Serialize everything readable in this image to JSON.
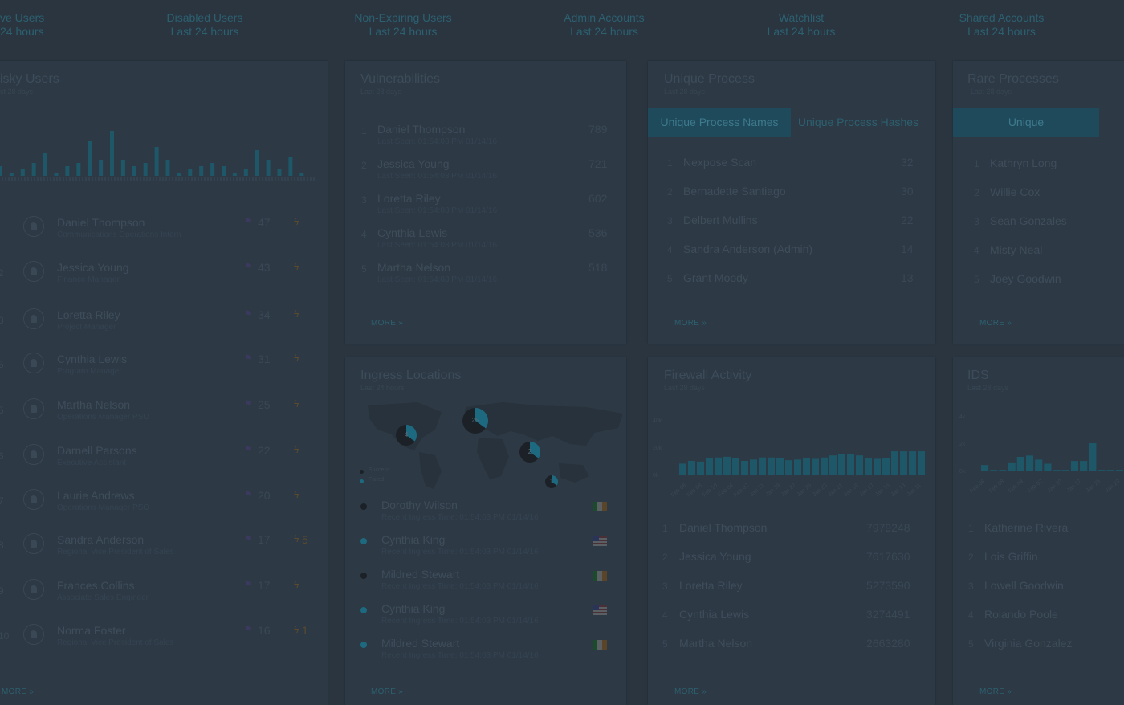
{
  "top_stats": [
    {
      "label": "ve Users",
      "sub": "24 hours"
    },
    {
      "label": "Disabled Users",
      "sub": "Last 24 hours"
    },
    {
      "label": "Non-Expiring Users",
      "sub": "Last 24 hours"
    },
    {
      "label": "Admin Accounts",
      "sub": "Last 24 hours"
    },
    {
      "label": "Watchlist",
      "sub": "Last 24 hours"
    },
    {
      "label": "Shared Accounts",
      "sub": "Last 24 hours"
    }
  ],
  "risky_users": {
    "title": "isky Users",
    "sub": "st 28 days",
    "more": "MORE »",
    "bars": [
      3,
      1,
      2,
      4,
      7,
      1,
      3,
      4,
      11,
      5,
      14,
      5,
      3,
      4,
      9,
      5,
      1,
      2,
      3,
      4,
      3,
      1,
      2,
      8,
      5,
      2,
      6,
      1
    ],
    "rows": [
      {
        "rank": "",
        "name": "Daniel Thompson",
        "role": "Communications Operations Intern",
        "flags": "47",
        "bolts": ""
      },
      {
        "rank": "2",
        "name": "Jessica Young",
        "role": "Finance Manager",
        "flags": "43",
        "bolts": ""
      },
      {
        "rank": "3",
        "name": "Loretta Riley",
        "role": "Project Manager",
        "flags": "34",
        "bolts": ""
      },
      {
        "rank": "5",
        "name": "Cynthia Lewis",
        "role": "Program Manager",
        "flags": "31",
        "bolts": ""
      },
      {
        "rank": "5",
        "name": "Martha Nelson",
        "role": "Operations Manager PSO",
        "flags": "25",
        "bolts": ""
      },
      {
        "rank": "6",
        "name": "Darnell Parsons",
        "role": "Executive Assistant",
        "flags": "22",
        "bolts": ""
      },
      {
        "rank": "7",
        "name": "Laurie Andrews",
        "role": "Operations Manager PSO",
        "flags": "20",
        "bolts": ""
      },
      {
        "rank": "8",
        "name": "Sandra Anderson",
        "role": "Regional Vice President of Sales",
        "flags": "17",
        "bolts": "5"
      },
      {
        "rank": "9",
        "name": "Frances Collins",
        "role": "Associate Sales Engineer",
        "flags": "17",
        "bolts": ""
      },
      {
        "rank": "10",
        "name": "Norma Foster",
        "role": "Regional Vice President of Sales",
        "flags": "16",
        "bolts": "1"
      }
    ]
  },
  "vulnerabilities": {
    "title": "Vulnerabilities",
    "sub": "Last 28 days",
    "more": "MORE »",
    "rows": [
      {
        "rank": "1",
        "name": "Daniel Thompson",
        "seen": "Last Seen: 01:54:03 PM 01/14/16",
        "value": "789"
      },
      {
        "rank": "2",
        "name": "Jessica Young",
        "seen": "Last Seen: 01:54:03 PM 01/14/16",
        "value": "721"
      },
      {
        "rank": "3",
        "name": "Loretta Riley",
        "seen": "Last Seen: 01:54:03 PM 01/14/16",
        "value": "602"
      },
      {
        "rank": "4",
        "name": "Cynthia Lewis",
        "seen": "Last Seen: 01:54:03 PM 01/14/16",
        "value": "536"
      },
      {
        "rank": "5",
        "name": "Martha Nelson",
        "seen": "Last Seen: 01:54:03 PM 01/14/16",
        "value": "518"
      }
    ]
  },
  "unique_process": {
    "title": "Unique Process",
    "sub": "Last 28 days",
    "tab_active": "Unique Process Names",
    "tab_inactive": "Unique Process Hashes",
    "more": "MORE »",
    "rows": [
      {
        "rank": "1",
        "name": "Nexpose Scan",
        "value": "32"
      },
      {
        "rank": "2",
        "name": "Bernadette Santiago",
        "value": "30"
      },
      {
        "rank": "3",
        "name": "Delbert Mullins",
        "value": "22"
      },
      {
        "rank": "4",
        "name": "Sandra Anderson (Admin)",
        "value": "14"
      },
      {
        "rank": "5",
        "name": "Grant Moody",
        "value": "13"
      }
    ]
  },
  "rare_processes": {
    "title": "Rare Processes",
    "sub": "Last 28 days",
    "tab_active": "Unique",
    "more": "MORE »",
    "rows": [
      {
        "rank": "1",
        "name": "Kathryn Long"
      },
      {
        "rank": "2",
        "name": "Willie Cox"
      },
      {
        "rank": "3",
        "name": "Sean Gonzales"
      },
      {
        "rank": "4",
        "name": "Misty Neal"
      },
      {
        "rank": "5",
        "name": "Joey Goodwin"
      }
    ]
  },
  "ingress": {
    "title": "Ingress Locations",
    "sub": "Last 24 hours",
    "more": "MORE »",
    "legend": [
      "Success",
      "Failed"
    ],
    "colors": {
      "success": "#1b2127",
      "failed": "#1d6a80"
    },
    "pies": [
      {
        "label": "4",
        "size": "medium"
      },
      {
        "label": "25",
        "size": "large"
      },
      {
        "label": "2",
        "size": "medium"
      },
      {
        "label": "1",
        "size": "small"
      }
    ],
    "rows": [
      {
        "name": "Dorothy Wilson",
        "time": "Recent Ingress Time: 01:54:03 PM 01/14/16",
        "status": "success",
        "flag": "ireland"
      },
      {
        "name": "Cynthia King",
        "time": "Recent Ingress Time: 01:54:03 PM 01/14/16",
        "status": "failed",
        "flag": "usa"
      },
      {
        "name": "Mildred Stewart",
        "time": "Recent Ingress Time: 01:54:03 PM 01/14/16",
        "status": "success",
        "flag": "ireland"
      },
      {
        "name": "Cynthia King",
        "time": "Recent Ingress Time: 01:54:03 PM 01/14/16",
        "status": "failed",
        "flag": "usa"
      },
      {
        "name": "Mildred Stewart",
        "time": "Recent Ingress Time: 01:54:03 PM 01/14/16",
        "status": "failed",
        "flag": "ireland"
      }
    ]
  },
  "firewall": {
    "title": "Firewall Activity",
    "sub": "Last 28 days",
    "more": "MORE »",
    "rows": [
      {
        "rank": "1",
        "name": "Daniel Thompson",
        "value": "7979248"
      },
      {
        "rank": "2",
        "name": "Jessica Young",
        "value": "7617630"
      },
      {
        "rank": "3",
        "name": "Loretta Riley",
        "value": "5273590"
      },
      {
        "rank": "4",
        "name": "Cynthia Lewis",
        "value": "3274491"
      },
      {
        "rank": "5",
        "name": "Martha Nelson",
        "value": "2663280"
      }
    ]
  },
  "ids": {
    "title": "IDS",
    "sub": "Last 28 days",
    "more": "MORE »",
    "rows": [
      {
        "rank": "1",
        "name": "Katherine Rivera"
      },
      {
        "rank": "2",
        "name": "Lois Griffin"
      },
      {
        "rank": "3",
        "name": "Lowell Goodwin"
      },
      {
        "rank": "4",
        "name": "Rolando Poole"
      },
      {
        "rank": "5",
        "name": "Virginia Gonzalez"
      }
    ]
  },
  "chart_data": [
    {
      "type": "bar",
      "title": "Firewall Activity",
      "yticks": [
        "40k",
        "20k",
        "0k"
      ],
      "ylim": [
        0,
        40000
      ],
      "categories": [
        "Feb 06",
        "Feb 08",
        "Feb 10",
        "Feb 04",
        "Feb 02",
        "Jan 31",
        "Jan 29",
        "Jan 27",
        "Jan 25",
        "Jan 23",
        "Jan 21",
        "Jan 19",
        "Jan 17",
        "Jan 15",
        "Jan 13",
        "Jan 11"
      ],
      "values": [
        8000,
        10000,
        9500,
        12000,
        12500,
        13000,
        12000,
        10000,
        11000,
        12500,
        12500,
        12000,
        10500,
        11000,
        12000,
        11500,
        12500,
        14000,
        15000,
        15000,
        14000,
        12000,
        11500,
        12000,
        17000,
        17000,
        17000,
        17000
      ]
    },
    {
      "type": "bar",
      "title": "IDS",
      "yticks": [
        "4k",
        "2k",
        "0k"
      ],
      "ylim": [
        0,
        4000
      ],
      "categories": [
        "Feb 06",
        "Feb 08",
        "Feb 04",
        "Feb 02",
        "Jan 30",
        "Jan 27",
        "Jan 25",
        "Jan 23"
      ],
      "values": [
        400,
        50,
        50,
        600,
        1000,
        1100,
        800,
        500,
        50,
        50,
        700,
        700,
        2000,
        50,
        50,
        50
      ]
    }
  ]
}
